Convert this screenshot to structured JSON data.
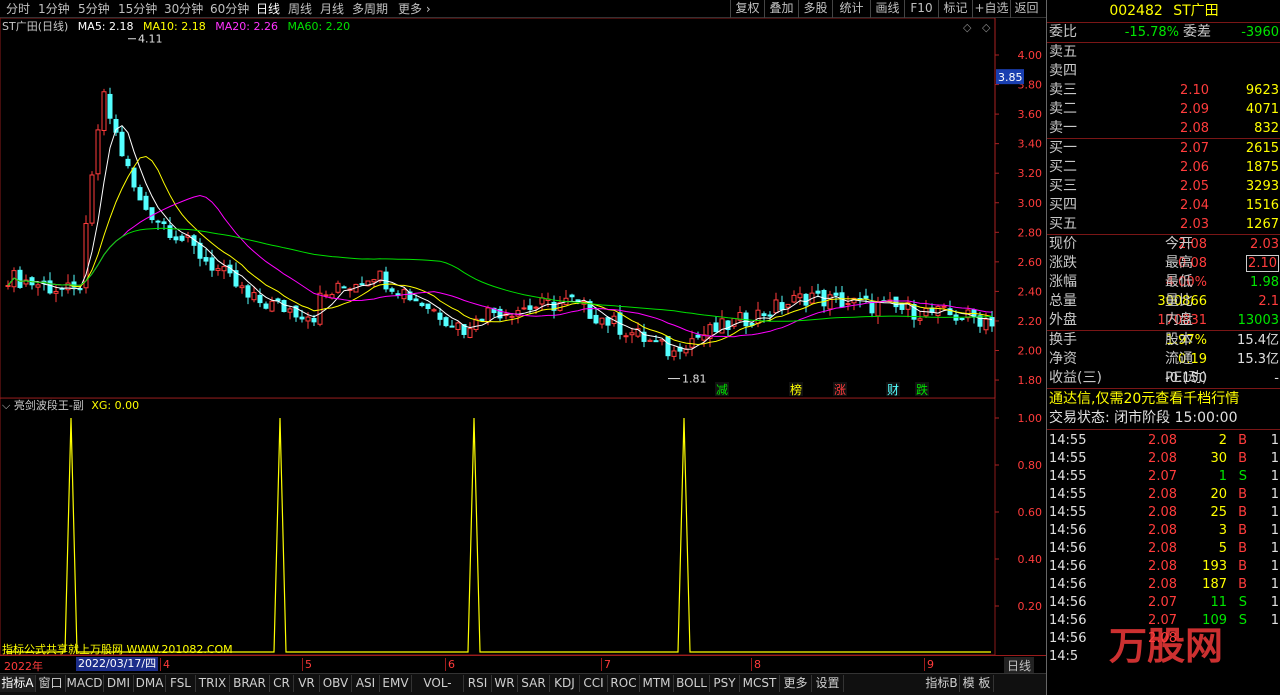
{
  "toolbar": {
    "periods": [
      "分时",
      "1分钟",
      "5分钟",
      "15分钟",
      "30分钟",
      "60分钟",
      "日线",
      "周线",
      "月线",
      "多周期",
      "更多 ›"
    ],
    "active_period": "日线",
    "actions": [
      "复权",
      "叠加",
      "多股",
      "统计",
      "画线",
      "F10",
      "标记",
      "+自选",
      "返回"
    ]
  },
  "main_chart": {
    "stock_label": "ST广田(日线)",
    "ma5": "MA5: 2.18",
    "ma10": "MA10: 2.18",
    "ma20": "MA20: 2.26",
    "ma60": "MA60: 2.20",
    "price_ticks": [
      "4.00",
      "3.80",
      "3.60",
      "3.40",
      "3.20",
      "3.00",
      "2.80",
      "2.60",
      "2.40",
      "2.20",
      "2.00",
      "1.80"
    ],
    "current_price_tag": "3.85",
    "high_annotation": "4.11",
    "low_annotation": "1.81",
    "event_markers": [
      "减",
      "榜",
      "涨",
      "财",
      "跌"
    ],
    "colors": {
      "ma5": "#ffffff",
      "ma10": "#ffff00",
      "ma20": "#ff00ff",
      "ma60": "#00e000",
      "up": "#ff3c3c",
      "down": "#54ffff"
    }
  },
  "sub_chart": {
    "name": "亮剑波段王-副",
    "value": "XG: 0.00",
    "ticks": [
      "1.00",
      "0.80",
      "0.60",
      "0.40",
      "0.20"
    ],
    "credit": "指标公式共享就上万股网 WWW.201082.COM"
  },
  "date_bar": {
    "year": "2022年",
    "cursor_date": "2022/03/17/四",
    "months": [
      "4",
      "5",
      "6",
      "7",
      "8",
      "9"
    ],
    "period": "日线"
  },
  "indicator_tabs": [
    "指标A",
    "窗口",
    "MACD",
    "DMI",
    "DMA",
    "FSL",
    "TRIX",
    "BRAR",
    "CR",
    "VR",
    "OBV",
    "ASI",
    "EMV",
    "VOL-TDX",
    "RSI",
    "WR",
    "SAR",
    "KDJ",
    "CCI",
    "ROC",
    "MTM",
    "BOLL",
    "PSY",
    "MCST",
    "更多",
    "设置",
    "指标B",
    "模 板"
  ],
  "quote": {
    "code": "002482",
    "name": "ST广田",
    "wei_bi_label": "委比",
    "wei_bi": "-15.78%",
    "wei_cha_label": "委差",
    "wei_cha": "-3960",
    "asks": [
      {
        "label": "卖五",
        "price": "",
        "vol": ""
      },
      {
        "label": "卖四",
        "price": "",
        "vol": ""
      },
      {
        "label": "卖三",
        "price": "2.10",
        "vol": "9623"
      },
      {
        "label": "卖二",
        "price": "2.09",
        "vol": "4071"
      },
      {
        "label": "卖一",
        "price": "2.08",
        "vol": "832"
      }
    ],
    "bids": [
      {
        "label": "买一",
        "price": "2.07",
        "vol": "2615"
      },
      {
        "label": "买二",
        "price": "2.06",
        "vol": "1875"
      },
      {
        "label": "买三",
        "price": "2.05",
        "vol": "3293"
      },
      {
        "label": "买四",
        "price": "2.04",
        "vol": "1516"
      },
      {
        "label": "买五",
        "price": "2.03",
        "vol": "1267"
      }
    ],
    "stats": [
      {
        "l1": "现价",
        "v1": "2.08",
        "l2": "今开",
        "v2": "2.03"
      },
      {
        "l1": "涨跌",
        "v1": "0.08",
        "l2": "最高",
        "v2": "2.10"
      },
      {
        "l1": "涨幅",
        "v1": "4.00%",
        "l2": "最低",
        "v2": "1.98"
      },
      {
        "l1": "总量",
        "v1": "300866",
        "l2": "量比",
        "v2": "2.1"
      },
      {
        "l1": "外盘",
        "v1": "170831",
        "l2": "内盘",
        "v2": "13003"
      }
    ],
    "stats2": [
      {
        "l1": "换手",
        "v1": "1.97%",
        "l2": "股本",
        "v2": "15.4亿"
      },
      {
        "l1": "净资",
        "v1": "0.19",
        "l2": "流通",
        "v2": "15.3亿"
      },
      {
        "l1": "收益(三)",
        "v1": "-0.150",
        "l2": "PE(动)",
        "v2": "-"
      }
    ],
    "promo": "通达信,仅需20元查看千档行情",
    "trade_status": "交易状态: 闭市阶段 15:00:00"
  },
  "ticks": [
    {
      "time": "14:55",
      "price": "2.08",
      "vol": "2",
      "side": "B",
      "n": "1"
    },
    {
      "time": "14:55",
      "price": "2.08",
      "vol": "30",
      "side": "B",
      "n": "1"
    },
    {
      "time": "14:55",
      "price": "2.07",
      "vol": "1",
      "side": "S",
      "n": "1"
    },
    {
      "time": "14:55",
      "price": "2.08",
      "vol": "20",
      "side": "B",
      "n": "1"
    },
    {
      "time": "14:55",
      "price": "2.08",
      "vol": "25",
      "side": "B",
      "n": "1"
    },
    {
      "time": "14:56",
      "price": "2.08",
      "vol": "3",
      "side": "B",
      "n": "1"
    },
    {
      "time": "14:56",
      "price": "2.08",
      "vol": "5",
      "side": "B",
      "n": "1"
    },
    {
      "time": "14:56",
      "price": "2.08",
      "vol": "193",
      "side": "B",
      "n": "1"
    },
    {
      "time": "14:56",
      "price": "2.08",
      "vol": "187",
      "side": "B",
      "n": "1"
    },
    {
      "time": "14:56",
      "price": "2.07",
      "vol": "11",
      "side": "S",
      "n": "1"
    },
    {
      "time": "14:56",
      "price": "2.07",
      "vol": "109",
      "side": "S",
      "n": "1"
    },
    {
      "time": "14:56",
      "price": "2.08",
      "vol": "",
      "side": "",
      "n": ""
    },
    {
      "time": "14:5",
      "price": "",
      "vol": "",
      "side": "",
      "n": ""
    }
  ],
  "watermark": "万股网"
}
